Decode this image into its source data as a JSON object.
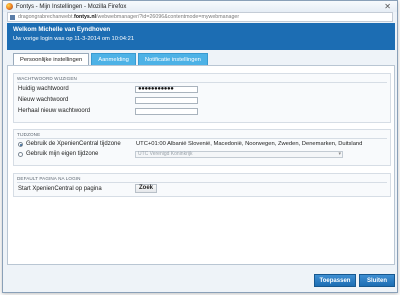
{
  "window": {
    "title": "Fontys - Mijn Instellingen - Mozilla Firefox",
    "close_glyph": "✕"
  },
  "urlbar": {
    "prefix": "dragongrabrechanwebt.",
    "host": "fontys.nl",
    "path": "/webwebmanager/?id=26096&contentmode=mywebmanager"
  },
  "header": {
    "welcome": "Welkom Michelle van Eyndhoven",
    "last_login": "Uw vorige login was op 11-3-2014 om 10:04:21"
  },
  "tabs": [
    {
      "label": "Persoonlijke instellingen",
      "active": true
    },
    {
      "label": "Aanmelding",
      "active": false
    },
    {
      "label": "Notificatie instellingen",
      "active": false
    }
  ],
  "password_section": {
    "title": "WACHTWOORD WIJZIGEN",
    "current_label": "Huidig wachtwoord",
    "current_value": "●●●●●●●●●●●",
    "new_label": "Nieuw wachtwoord",
    "new_value": "",
    "repeat_label": "Herhaal nieuw wachtwoord",
    "repeat_value": ""
  },
  "timezone_section": {
    "title": "TIJDZONE",
    "option_xpc_label": "Gebruik de XpenienCentral tijdzone",
    "option_xpc_value": "UTC+01:00 Albanië Slovenië, Macedonië, Noorwegen, Zweden, Denemarken, Duitsland",
    "option_own_label": "Gebruik mijn eigen tijdzone",
    "own_select_value": "UTC Verenigd Koninkrijk",
    "selected": "xpc"
  },
  "startpage_section": {
    "title": "DEFAULT PAGINA NA LOGIN",
    "label": "Start XpenienCentral op pagina",
    "button": "Zoek"
  },
  "footer": {
    "apply": "Toepassen",
    "close": "Sluiten"
  },
  "colors": {
    "header_blue": "#1c6db3",
    "tab_blue": "#4db2e6"
  }
}
